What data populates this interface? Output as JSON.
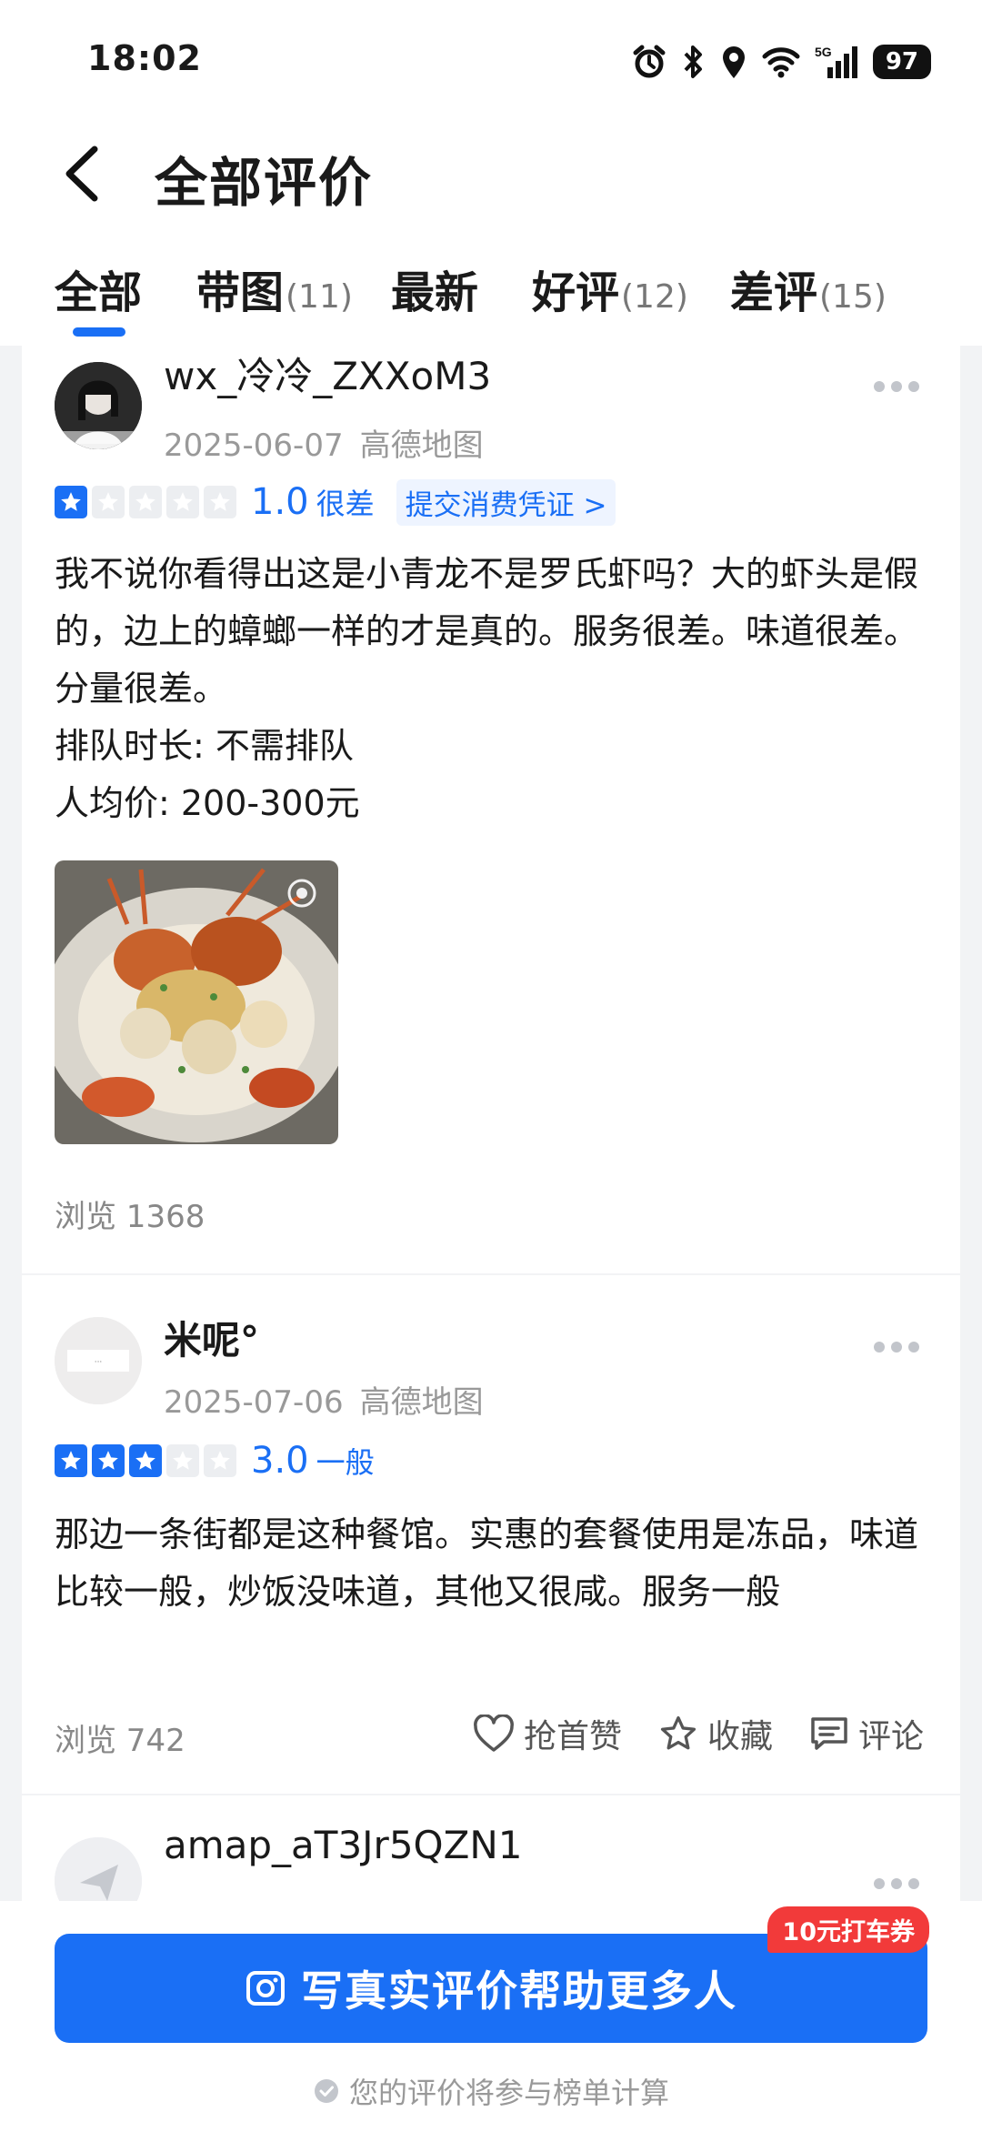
{
  "status_bar": {
    "time": "18:02",
    "battery": "97",
    "network": "5G"
  },
  "header": {
    "title": "全部评价"
  },
  "tabs": [
    {
      "label": "全部",
      "count": ""
    },
    {
      "label": "带图",
      "count": "(11)"
    },
    {
      "label": "最新",
      "count": ""
    },
    {
      "label": "好评",
      "count": "(12)"
    },
    {
      "label": "差评",
      "count": "(15)"
    }
  ],
  "reviews": [
    {
      "username": "wx_冷冷_ZXXoM3",
      "date": "2025-06-07",
      "source": "高德地图",
      "rating": "1.0",
      "rating_value": 1,
      "rating_word": "很差",
      "voucher": "提交消费凭证 >",
      "text": [
        "我不说你看得出这是小青龙不是罗氏虾吗？大的虾头是假的，边上的蟑螂一样的才是真的。服务很差。味道很差。分量很差。",
        "排队时长: 不需排队",
        "人均价: 200-300元"
      ],
      "views": "浏览 1368"
    },
    {
      "username": "米呢°",
      "date": "2025-07-06",
      "source": "高德地图",
      "rating": "3.0",
      "rating_value": 3,
      "rating_word": "一般",
      "text": [
        "那边一条街都是这种餐馆。实惠的套餐使用是冻品，味道比较一般，炒饭没味道，其他又很咸。服务一般"
      ],
      "views": "浏览 742",
      "actions": {
        "like": "抢首赞",
        "collect": "收藏",
        "comment": "评论"
      }
    },
    {
      "username": "amap_aT3Jr5QZN1"
    }
  ],
  "bottom": {
    "cta_label": "写真实评价帮助更多人",
    "coupon_badge": "10元打车券",
    "footer_note": "您的评价将参与榜单计算"
  },
  "colors": {
    "accent": "#1a6ff5",
    "badge": "#f23a3a",
    "background": "#f2f3f5"
  }
}
